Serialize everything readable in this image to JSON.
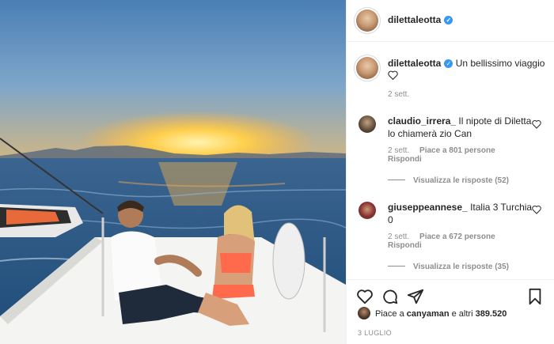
{
  "post": {
    "author": "dilettaleotta",
    "caption": "Un bellissimo viaggio",
    "caption_time": "2 sett."
  },
  "comments": [
    {
      "user": "claudio_irrera_",
      "text_line1": "Il nipote di Diletta",
      "text_line2": "lo chiamerà zio Can",
      "time": "2 sett.",
      "likes": "Piace a 801 persone",
      "reply": "Rispondi",
      "view_replies": "Visualizza le risposte (52)"
    },
    {
      "user": "giuseppeannese_",
      "text_line1": "Italia 3 Turchia",
      "text_line2": "0",
      "time": "2 sett.",
      "likes": "Piace a 672 persone",
      "reply": "Rispondi",
      "view_replies": "Visualizza le risposte (35)"
    }
  ],
  "likes_summary": {
    "prefix": "Piace a ",
    "user": "canyaman",
    "suffix": " e altri ",
    "count": "389.520"
  },
  "post_date": "3 LUGLIO",
  "icons": {
    "like": "heart-icon",
    "comment": "comment-icon",
    "share": "share-icon",
    "save": "bookmark-icon",
    "verified": "verified-badge-icon"
  },
  "colors": {
    "verified": "#3897f0",
    "meta_text": "#8e8e8e",
    "text": "#262626"
  }
}
